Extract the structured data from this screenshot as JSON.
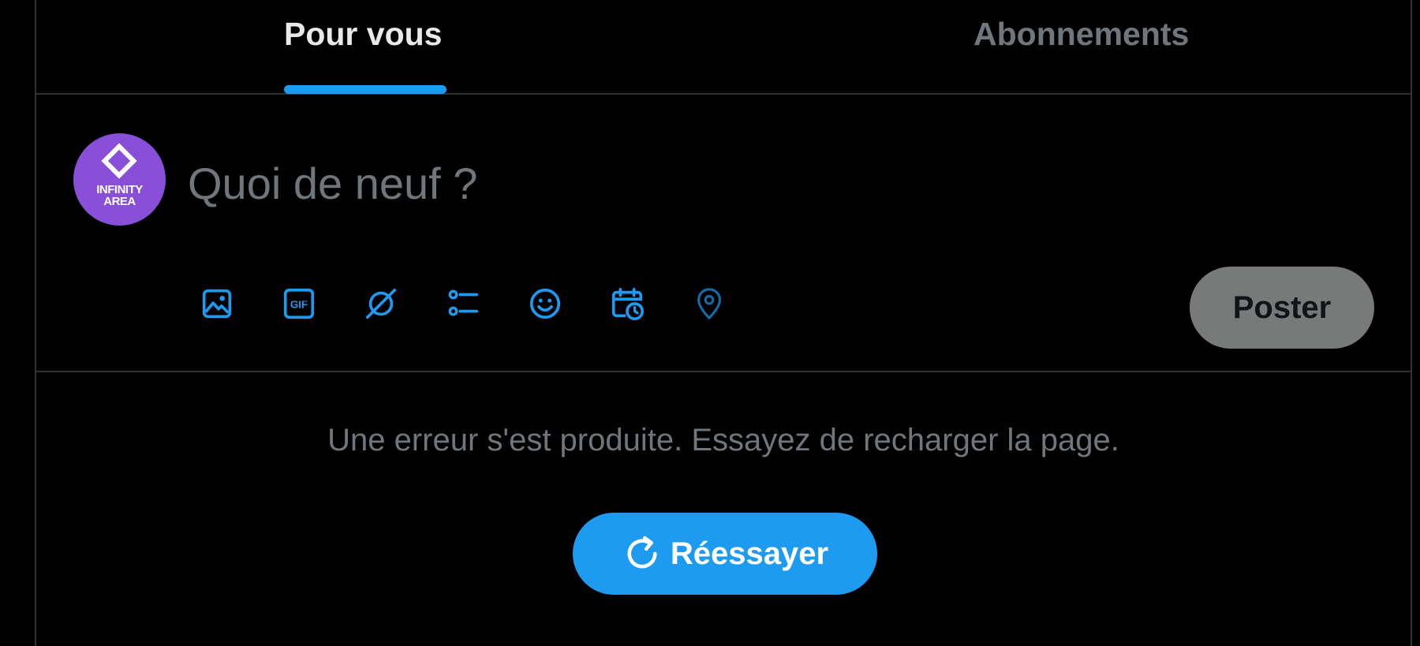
{
  "tabs": [
    {
      "label": "Pour vous",
      "selected": true
    },
    {
      "label": "Abonnements",
      "selected": false
    }
  ],
  "composer": {
    "avatar": {
      "line1": "INFINITY",
      "line2": "AREA",
      "color": "#8a4fd8"
    },
    "placeholder": "Quoi de neuf ?",
    "toolbar": [
      {
        "icon": "image-icon"
      },
      {
        "icon": "gif-icon",
        "label": "GIF"
      },
      {
        "icon": "grok-icon"
      },
      {
        "icon": "poll-icon"
      },
      {
        "icon": "emoji-icon"
      },
      {
        "icon": "schedule-icon"
      },
      {
        "icon": "location-icon"
      }
    ],
    "post_label": "Poster"
  },
  "error": {
    "message": "Une erreur s'est produite. Essayez de recharger la page.",
    "retry_label": "Réessayer",
    "retry_icon": "refresh-icon"
  },
  "colors": {
    "accent": "#1d9bf0",
    "background": "#000000",
    "border": "#2f3336",
    "text_primary": "#e7e9ea",
    "text_secondary": "#71767b",
    "post_button_disabled": "#787a7a"
  }
}
